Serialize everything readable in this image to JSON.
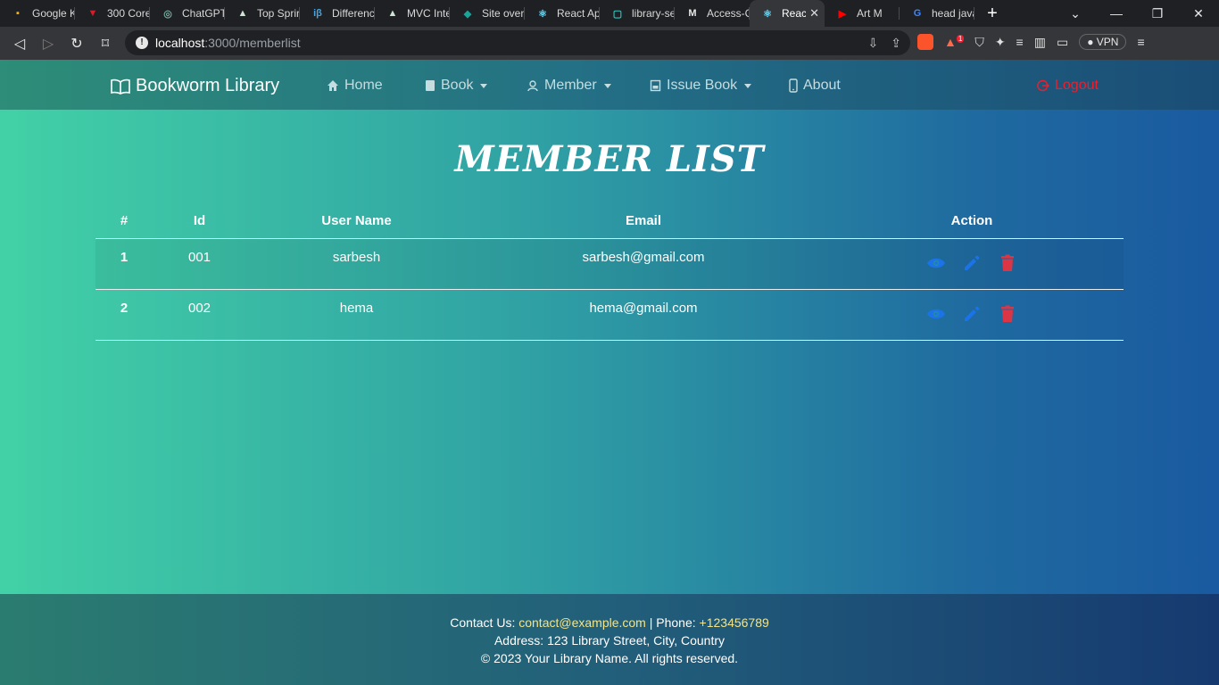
{
  "browser": {
    "tabs": [
      {
        "title": "Google K",
        "favicon_color": "#f4b400",
        "glyph": "▪"
      },
      {
        "title": "300 Core",
        "favicon_color": "#d71e28",
        "glyph": "▼"
      },
      {
        "title": "ChatGPT",
        "favicon_color": "#74aa9c",
        "glyph": "◎"
      },
      {
        "title": "Top Sprir",
        "favicon_color": "#cde5d4",
        "glyph": "▲"
      },
      {
        "title": "Differenc",
        "favicon_color": "#4aa3df",
        "glyph": "iβ"
      },
      {
        "title": "MVC Inte",
        "favicon_color": "#cde5d4",
        "glyph": "▲"
      },
      {
        "title": "Site over",
        "favicon_color": "#1aa39a",
        "glyph": "◆"
      },
      {
        "title": "React Ap",
        "favicon_color": "#61dafb",
        "glyph": "⚛"
      },
      {
        "title": "library-se",
        "favicon_color": "#2ec7c0",
        "glyph": "▢"
      },
      {
        "title": "Access-C",
        "favicon_color": "#e8e8e8",
        "glyph": "M"
      },
      {
        "title": "React",
        "favicon_color": "#61dafb",
        "glyph": "⚛",
        "active": true
      },
      {
        "title": "Art M",
        "favicon_color": "#ff0000",
        "glyph": "▶"
      },
      {
        "title": "head java",
        "favicon_color": "#4285f4",
        "glyph": "G"
      }
    ],
    "url_host": "localhost",
    "url_path": ":3000/memberlist",
    "vpn_label": "VPN",
    "badge_count": "1"
  },
  "navbar": {
    "brand": "Bookworm Library",
    "items": [
      "Home",
      "Book",
      "Member",
      "Issue Book",
      "About"
    ],
    "logout": "Logout"
  },
  "main": {
    "title": "MEMBER LIST",
    "columns": [
      "#",
      "Id",
      "User Name",
      "Email",
      "Action"
    ],
    "rows": [
      {
        "num": "1",
        "id": "001",
        "username": "sarbesh",
        "email": "sarbesh@gmail.com"
      },
      {
        "num": "2",
        "id": "002",
        "username": "hema",
        "email": "hema@gmail.com"
      }
    ],
    "action_icons": [
      "view-icon",
      "edit-icon",
      "delete-icon"
    ]
  },
  "footer": {
    "contact_prefix": "Contact Us: ",
    "email": "contact@example.com",
    "phone_sep": " | Phone: ",
    "phone": "+123456789",
    "address": "Address: 123 Library Street, City, Country",
    "copyright": "© 2023 Your Library Name. All rights reserved."
  },
  "colors": {
    "view": "#1a73e8",
    "edit": "#1a73e8",
    "delete": "#dc3545",
    "logout": "#ef1e2c",
    "footer_highlight": "#f1e48a"
  }
}
